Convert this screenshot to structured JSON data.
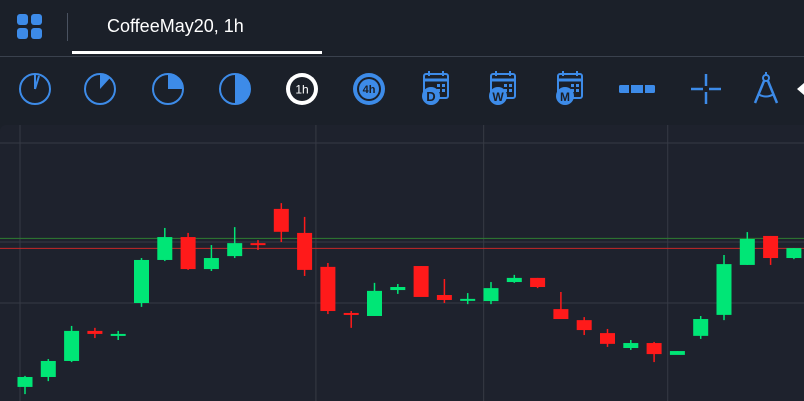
{
  "header": {
    "tab_title": "CoffeeMay20, 1h"
  },
  "toolbar": {
    "buttons": [
      {
        "name": "interval-1m-button",
        "icon": "clock-quarter-icon"
      },
      {
        "name": "interval-5m-button",
        "icon": "clock-sixth-icon"
      },
      {
        "name": "interval-15m-button",
        "icon": "clock-quarter-fill-icon"
      },
      {
        "name": "interval-30m-button",
        "icon": "clock-half-icon"
      },
      {
        "name": "interval-1h-button",
        "icon": "clock-1h-icon",
        "label": "1h",
        "selected": true
      },
      {
        "name": "interval-4h-button",
        "icon": "clock-4h-icon",
        "label": "4h"
      },
      {
        "name": "interval-day-button",
        "icon": "calendar-day-icon",
        "label": "D"
      },
      {
        "name": "interval-week-button",
        "icon": "calendar-week-icon",
        "label": "W"
      },
      {
        "name": "interval-month-button",
        "icon": "calendar-month-icon",
        "label": "M"
      },
      {
        "name": "horizontal-line-tool-button",
        "icon": "horizontal-line-icon"
      },
      {
        "name": "crosshair-tool-button",
        "icon": "crosshair-icon"
      },
      {
        "name": "compass-tool-button",
        "icon": "drawing-compass-icon"
      }
    ]
  },
  "colors": {
    "background": "#1b2029",
    "chart_background": "#1e222d",
    "accent": "#3d8be8",
    "up": "#00e676",
    "down": "#ff1a1a",
    "grid": "#363a45"
  },
  "chart_data": {
    "type": "candlestick",
    "title": "",
    "xlabel": "",
    "ylabel": "",
    "ylim": [
      0,
      100
    ],
    "grid": true,
    "price_lines": [
      {
        "value": 58.9,
        "color": "#2e7d32"
      },
      {
        "value": 55.3,
        "color": "#c62828"
      }
    ],
    "candles": [
      {
        "open": 5.1,
        "high": 9.1,
        "low": 2.5,
        "close": 8.7
      },
      {
        "open": 8.7,
        "high": 15.2,
        "low": 7.2,
        "close": 14.5
      },
      {
        "open": 14.5,
        "high": 27.2,
        "low": 14.1,
        "close": 25.4
      },
      {
        "open": 25.4,
        "high": 26.5,
        "low": 22.8,
        "close": 24.3
      },
      {
        "open": 24.3,
        "high": 25.4,
        "low": 22.1,
        "close": 24.3
      },
      {
        "open": 35.5,
        "high": 51.8,
        "low": 34.1,
        "close": 51.1
      },
      {
        "open": 51.1,
        "high": 62.7,
        "low": 50.7,
        "close": 59.4
      },
      {
        "open": 59.4,
        "high": 60.9,
        "low": 47.5,
        "close": 47.8
      },
      {
        "open": 47.8,
        "high": 56.5,
        "low": 47.1,
        "close": 51.8
      },
      {
        "open": 52.5,
        "high": 63.0,
        "low": 51.8,
        "close": 57.2
      },
      {
        "open": 57.2,
        "high": 58.3,
        "low": 54.7,
        "close": 56.5
      },
      {
        "open": 69.6,
        "high": 71.7,
        "low": 57.6,
        "close": 61.3
      },
      {
        "open": 60.9,
        "high": 66.7,
        "low": 45.3,
        "close": 47.5
      },
      {
        "open": 48.6,
        "high": 50.0,
        "low": 31.5,
        "close": 32.6
      },
      {
        "open": 31.9,
        "high": 32.6,
        "low": 26.5,
        "close": 31.2
      },
      {
        "open": 30.8,
        "high": 42.8,
        "low": 30.8,
        "close": 39.9
      },
      {
        "open": 40.2,
        "high": 42.4,
        "low": 38.8,
        "close": 41.3
      },
      {
        "open": 48.9,
        "high": 48.9,
        "low": 38.0,
        "close": 37.7
      },
      {
        "open": 38.4,
        "high": 44.2,
        "low": 35.5,
        "close": 36.6
      },
      {
        "open": 37.0,
        "high": 39.1,
        "low": 35.1,
        "close": 37.0
      },
      {
        "open": 36.2,
        "high": 43.1,
        "low": 35.1,
        "close": 40.9
      },
      {
        "open": 43.1,
        "high": 45.7,
        "low": 42.8,
        "close": 44.6
      },
      {
        "open": 44.6,
        "high": 44.6,
        "low": 40.9,
        "close": 41.3
      },
      {
        "open": 33.3,
        "high": 39.5,
        "low": 29.7,
        "close": 29.7
      },
      {
        "open": 29.3,
        "high": 30.4,
        "low": 23.9,
        "close": 25.7
      },
      {
        "open": 24.6,
        "high": 26.1,
        "low": 19.6,
        "close": 20.7
      },
      {
        "open": 19.2,
        "high": 22.1,
        "low": 18.5,
        "close": 21.0
      },
      {
        "open": 21.0,
        "high": 21.4,
        "low": 14.1,
        "close": 17.0
      },
      {
        "open": 16.7,
        "high": 18.1,
        "low": 17.0,
        "close": 18.1
      },
      {
        "open": 23.6,
        "high": 30.8,
        "low": 22.5,
        "close": 29.7
      },
      {
        "open": 31.2,
        "high": 52.9,
        "low": 29.3,
        "close": 49.6
      },
      {
        "open": 49.3,
        "high": 61.2,
        "low": 49.3,
        "close": 58.7
      },
      {
        "open": 59.8,
        "high": 59.8,
        "low": 49.3,
        "close": 51.8
      },
      {
        "open": 51.8,
        "high": 55.4,
        "low": 51.4,
        "close": 55.4
      }
    ]
  }
}
